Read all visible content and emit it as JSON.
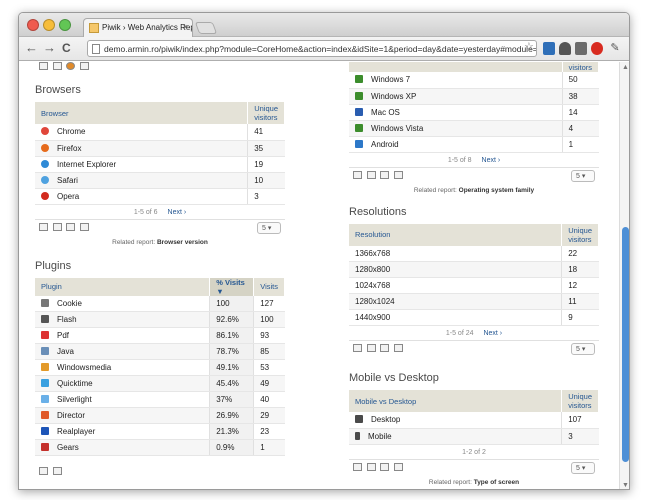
{
  "browser": {
    "tab_title": "Piwik › Web Analytics Reports",
    "tab_close": "×",
    "url": "demo.armin.ro/piwik/index.php?module=CoreHome&action=index&idSite=1&period=day&date=yesterday#module=Us...",
    "back": "←",
    "forward": "→",
    "reload": "C",
    "star": "☆"
  },
  "browsers": {
    "title": "Browsers",
    "col_label": "Browser",
    "col_value": "Unique visitors",
    "rows": [
      {
        "label": "Chrome",
        "value": "41",
        "color": "#e0463a"
      },
      {
        "label": "Firefox",
        "value": "35",
        "color": "#e66b1c"
      },
      {
        "label": "Internet Explorer",
        "value": "19",
        "color": "#2f8ad6"
      },
      {
        "label": "Safari",
        "value": "10",
        "color": "#4fa2e0"
      },
      {
        "label": "Opera",
        "value": "3",
        "color": "#d22a1e"
      }
    ],
    "pager": "1-5 of 6",
    "next": "Next ›",
    "limit": "5",
    "related_prefix": "Related report:",
    "related_name": "Browser version"
  },
  "plugins": {
    "title": "Plugins",
    "col_label": "Plugin",
    "col_pct": "% Visits ▼",
    "col_visits": "Visits",
    "rows": [
      {
        "label": "Cookie",
        "pct": "100",
        "visits": "127",
        "color": "#777"
      },
      {
        "label": "Flash",
        "pct": "92.6%",
        "visits": "100",
        "color": "#555"
      },
      {
        "label": "Pdf",
        "pct": "86.1%",
        "visits": "93",
        "color": "#d33"
      },
      {
        "label": "Java",
        "pct": "78.7%",
        "visits": "85",
        "color": "#6a8fb8"
      },
      {
        "label": "Windowsmedia",
        "pct": "49.1%",
        "visits": "53",
        "color": "#e39a2a"
      },
      {
        "label": "Quicktime",
        "pct": "45.4%",
        "visits": "49",
        "color": "#3aa0e0"
      },
      {
        "label": "Silverlight",
        "pct": "37%",
        "visits": "40",
        "color": "#6ab0e8"
      },
      {
        "label": "Director",
        "pct": "26.9%",
        "visits": "29",
        "color": "#e05a2a"
      },
      {
        "label": "Realplayer",
        "pct": "21.3%",
        "visits": "23",
        "color": "#1d55b8"
      },
      {
        "label": "Gears",
        "pct": "0.9%",
        "visits": "1",
        "color": "#c4302b"
      }
    ]
  },
  "os": {
    "col_value": "visitors",
    "rows": [
      {
        "label": "Windows 7",
        "value": "50",
        "color": "#3c8d2c"
      },
      {
        "label": "Windows XP",
        "value": "38",
        "color": "#3c8d2c"
      },
      {
        "label": "Mac OS",
        "value": "14",
        "color": "#2a5db0"
      },
      {
        "label": "Windows Vista",
        "value": "4",
        "color": "#3c8d2c"
      },
      {
        "label": "Android",
        "value": "1",
        "color": "#2d78c8"
      }
    ],
    "pager": "1-5 of 8",
    "next": "Next ›",
    "limit": "5",
    "related_prefix": "Related report:",
    "related_name": "Operating system family"
  },
  "resolutions": {
    "title": "Resolutions",
    "col_label": "Resolution",
    "col_value": "Unique visitors",
    "rows": [
      {
        "label": "1366x768",
        "value": "22"
      },
      {
        "label": "1280x800",
        "value": "18"
      },
      {
        "label": "1024x768",
        "value": "12"
      },
      {
        "label": "1280x1024",
        "value": "11"
      },
      {
        "label": "1440x900",
        "value": "9"
      }
    ],
    "pager": "1-5 of 24",
    "next": "Next ›",
    "limit": "5"
  },
  "mobile": {
    "title": "Mobile vs Desktop",
    "col_label": "Mobile vs Desktop",
    "col_value": "Unique visitors",
    "rows": [
      {
        "label": "Desktop",
        "value": "107",
        "color": "#4a4a4a"
      },
      {
        "label": "Mobile",
        "value": "3",
        "color": "#4a4a4a"
      }
    ],
    "pager": "1-2 of 2",
    "limit": "5",
    "related_prefix": "Related report:",
    "related_name": "Type of screen"
  }
}
